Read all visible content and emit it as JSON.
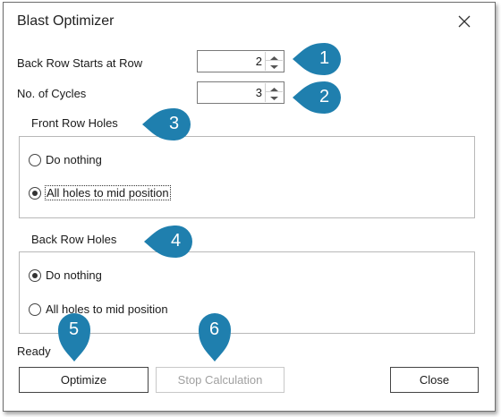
{
  "window": {
    "title": "Blast Optimizer",
    "close_icon": "close-icon"
  },
  "fields": {
    "back_row_start": {
      "label": "Back Row Starts at Row",
      "value": "2"
    },
    "cycles": {
      "label": "No. of Cycles",
      "value": "3"
    }
  },
  "front_row": {
    "title": "Front Row Holes",
    "options": [
      {
        "label": "Do nothing",
        "selected": false
      },
      {
        "label": "All holes to mid position",
        "selected": true
      }
    ]
  },
  "back_row": {
    "title": "Back Row Holes",
    "options": [
      {
        "label": "Do nothing",
        "selected": true
      },
      {
        "label": "All holes to mid position",
        "selected": false
      }
    ]
  },
  "status": "Ready",
  "buttons": {
    "optimize": "Optimize",
    "stop": "Stop Calculation",
    "close": "Close"
  },
  "callouts": [
    "1",
    "2",
    "3",
    "4",
    "5",
    "6"
  ],
  "colors": {
    "callout": "#1f7fae",
    "border": "#6e6e6e",
    "disabled": "#a0a0a0"
  }
}
